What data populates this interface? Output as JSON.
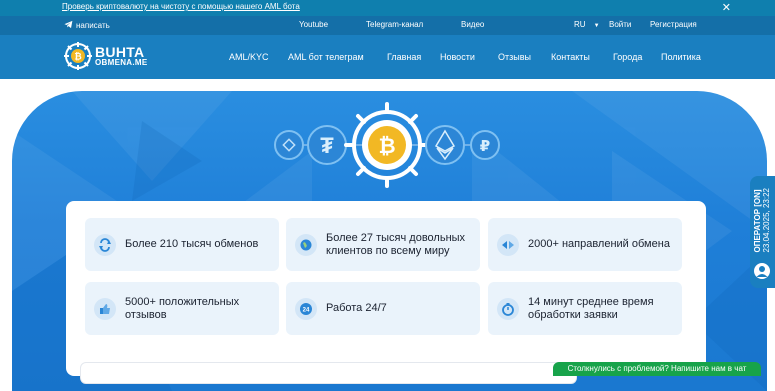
{
  "promo": {
    "link_text": "Проверь криптовалюту на чистоту с помощью нашего AML бота",
    "close": "✕"
  },
  "topbar": {
    "write": "написать",
    "youtube": "Youtube",
    "telegram": "Telegram-канал",
    "video": "Видео",
    "lang": "RU",
    "login": "Войти",
    "register": "Регистрация"
  },
  "logo": {
    "main": "BUHTA",
    "sub": "OBMENA.ME"
  },
  "nav": [
    "AML/KYC",
    "AML бот телеграм",
    "Главная",
    "Новости",
    "Отзывы",
    "Контакты",
    "Города",
    "Политика"
  ],
  "features": [
    {
      "text": "Более 210 тысяч обменов",
      "icon": "exchange-icon"
    },
    {
      "text": "Более 27 тысяч довольных клиентов по всему миру",
      "icon": "globe-icon"
    },
    {
      "text": "2000+ направлений обмена",
      "icon": "directions-icon"
    },
    {
      "text": "5000+ положительных отзывов",
      "icon": "thumbs-up-icon"
    },
    {
      "text": "Работа 24/7",
      "icon": "clock-24-icon"
    },
    {
      "text": "14 минут среднее время обработки заявки",
      "icon": "timer-icon"
    }
  ],
  "operator": {
    "status": "ОПЕРАТОР [ON]",
    "datetime": "23.04.2025, 23:22"
  },
  "chat": {
    "label": "Столкнулись с проблемой? Напишите нам в чат"
  },
  "colors": {
    "primary": "#1a7fc0",
    "accent_gold": "#f2b824",
    "chat_green": "#17a34a"
  }
}
